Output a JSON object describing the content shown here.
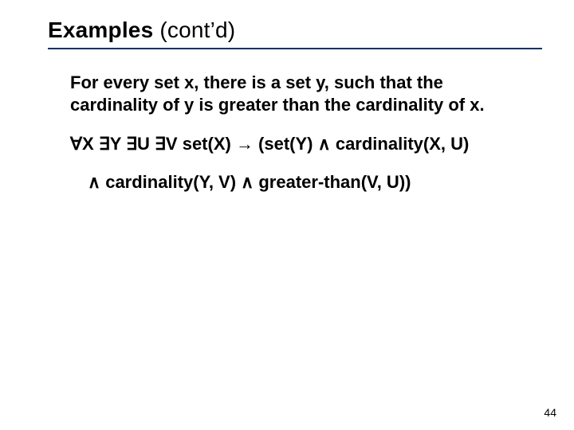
{
  "title_bold": "Examples",
  "title_rest": " (cont’d)",
  "para1": "For every set x, there is a set y, such that the cardinality of y is greater than the cardinality of x.",
  "formula_line1": "∀X ∃Y ∃U ∃V set(X) → (set(Y) ∧ cardinality(X, U)",
  "formula_line2": "∧ cardinality(Y, V) ∧ greater-than(V, U))",
  "page_number": "44"
}
